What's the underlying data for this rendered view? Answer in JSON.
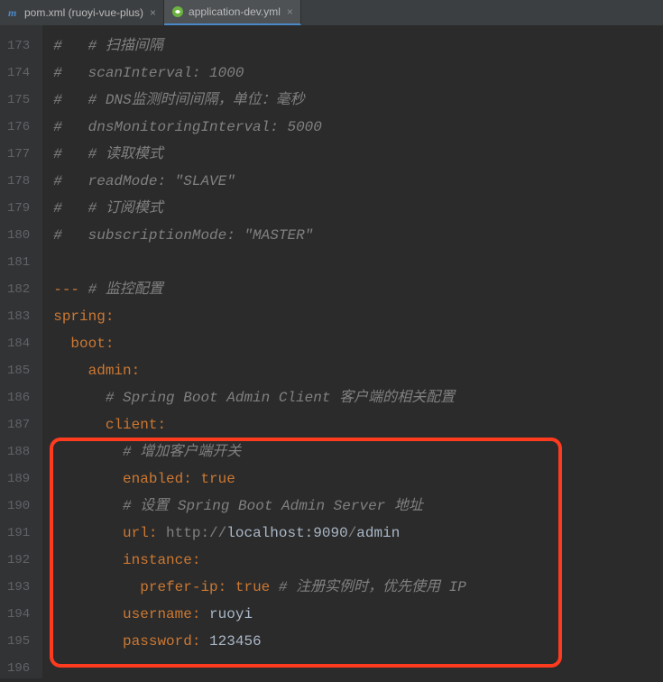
{
  "tabs": [
    {
      "label": "pom.xml (ruoyi-vue-plus)",
      "active": false
    },
    {
      "label": "application-dev.yml",
      "active": true
    }
  ],
  "gutter_start": 173,
  "gutter_end": 196,
  "lines": {
    "l173a": "#   ",
    "l173b": "# 扫描间隔",
    "l174a": "#   ",
    "l174b": "scanInterval: 1000",
    "l175a": "#   ",
    "l175b": "# DNS监测时间间隔，单位：毫秒",
    "l176a": "#   ",
    "l176b": "dnsMonitoringInterval: 5000",
    "l177a": "#   ",
    "l177b": "# 读取模式",
    "l178a": "#   ",
    "l178b": "readMode: \"SLAVE\"",
    "l179a": "#   ",
    "l179b": "# 订阅模式",
    "l180a": "#   ",
    "l180b": "subscriptionMode: \"MASTER\"",
    "l182a": "--- ",
    "l182b": "# 监控配置",
    "l183": "spring",
    "l184": "boot",
    "l185": "admin",
    "l186": "# Spring Boot Admin Client 客户端的相关配置",
    "l187": "client",
    "l188": "# 增加客户端开关",
    "l189a": "enabled",
    "l189b": "true",
    "l190": "# 设置 Spring Boot Admin Server 地址",
    "l191a": "url",
    "l191b": "http://",
    "l191c": "localhost:9090",
    "l191d": "/",
    "l191e": "admin",
    "l192": "instance",
    "l193a": "prefer-ip",
    "l193b": "true",
    "l193c": " # 注册实例时，优先使用 IP",
    "l194a": "username",
    "l194b": "ruoyi",
    "l195a": "password",
    "l195b": "123456"
  }
}
